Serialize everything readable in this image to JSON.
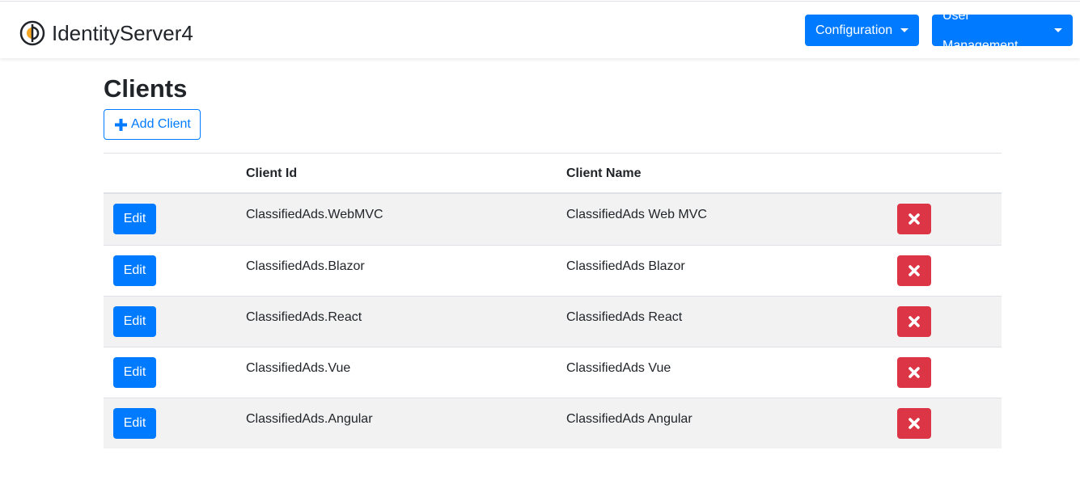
{
  "navbar": {
    "brand": "IdentityServer4",
    "logo_icon": "identityserver-logo-icon",
    "configuration_label": "Configuration",
    "user_management_label": "User Management",
    "accent_color": "#007bff"
  },
  "page": {
    "title": "Clients",
    "add_button_label": "Add Client",
    "add_button_icon": "plus-icon"
  },
  "table": {
    "columns": [
      "",
      "Client Id",
      "Client Name",
      ""
    ],
    "edit_label": "Edit",
    "delete_icon": "close-icon",
    "delete_color": "#dc3545",
    "rows": [
      {
        "client_id": "ClassifiedAds.WebMVC",
        "client_name": "ClassifiedAds Web MVC"
      },
      {
        "client_id": "ClassifiedAds.Blazor",
        "client_name": "ClassifiedAds Blazor"
      },
      {
        "client_id": "ClassifiedAds.React",
        "client_name": "ClassifiedAds React"
      },
      {
        "client_id": "ClassifiedAds.Vue",
        "client_name": "ClassifiedAds Vue"
      },
      {
        "client_id": "ClassifiedAds.Angular",
        "client_name": "ClassifiedAds Angular"
      }
    ]
  }
}
